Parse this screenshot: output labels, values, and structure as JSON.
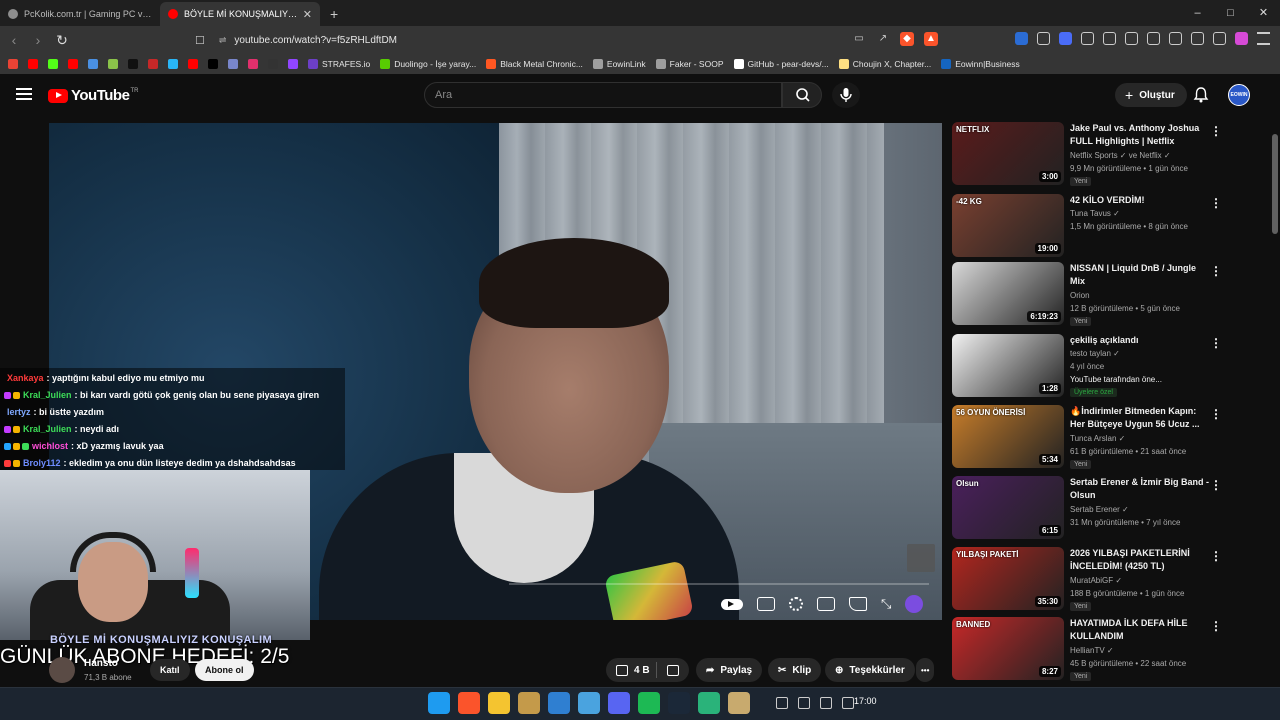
{
  "browser": {
    "tabs": [
      {
        "title": "PcKolik.com.tr | Gaming PC ve Bilgisayar",
        "active": false,
        "color": "#8e8e8e"
      },
      {
        "title": "BÖYLE Mİ KONUŞMALIYIZ KONUŞ",
        "active": true,
        "color": "#ff0000"
      }
    ],
    "new_tab": "+",
    "window_controls": [
      "–",
      "□",
      "✕"
    ],
    "url_site_label": "⇌",
    "url": "youtube.com/watch?v=f5zRHLdftDM",
    "bookmarks": [
      {
        "label": "",
        "color": "#ea4335"
      },
      {
        "label": "",
        "color": "#ff0000"
      },
      {
        "label": "",
        "color": "#53fc18"
      },
      {
        "label": "",
        "color": "#ff0000"
      },
      {
        "label": "",
        "color": "#4a90e2"
      },
      {
        "label": "",
        "color": "#8bc34a"
      },
      {
        "label": "",
        "color": "#111111"
      },
      {
        "label": "",
        "color": "#c62828"
      },
      {
        "label": "",
        "color": "#29b6f6"
      },
      {
        "label": "",
        "color": "#ff0000"
      },
      {
        "label": "",
        "color": "#000000"
      },
      {
        "label": "",
        "color": "#7986cb"
      },
      {
        "label": "",
        "color": "#e1306c"
      },
      {
        "label": "",
        "color": "#333333"
      },
      {
        "label": "",
        "color": "#9146ff"
      },
      {
        "label": "STRAFES.io",
        "color": "#6c3fc7"
      },
      {
        "label": "Duolingo - İşe yaray...",
        "color": "#58cc02"
      },
      {
        "label": "Black Metal Chronic...",
        "color": "#ff5722"
      },
      {
        "label": "EowinLink",
        "color": "#9e9e9e"
      },
      {
        "label": "Faker - SOOP",
        "color": "#9e9e9e"
      },
      {
        "label": "GitHub - pear-devs/...",
        "color": "#ffffff"
      },
      {
        "label": "Choujin X, Chapter...",
        "color": "#ffe082"
      },
      {
        "label": "Eowinn|Business",
        "color": "#1565c0"
      }
    ]
  },
  "youtube": {
    "logo_text": "YouTube",
    "country_code": "TR",
    "search_placeholder": "Ara",
    "create_label": "Oluştur",
    "avatar_label": "EOWIN"
  },
  "video": {
    "chat": [
      {
        "user": "Xankaya",
        "user_color": "#ff3b3b",
        "message": ": yaptığını kabul ediyo mu etmiyo mu",
        "badges": []
      },
      {
        "user": "Kral_Julien",
        "user_color": "#3ddc58",
        "message": ": bi karı vardı götü çok geniş olan bu sene piyasaya giren",
        "badges": [
          "#c43cff",
          "#f5b400"
        ]
      },
      {
        "user": "lertyz",
        "user_color": "#7fa8ff",
        "message": ": bi üstte yazdım",
        "badges": []
      },
      {
        "user": "Kral_Julien",
        "user_color": "#3ddc58",
        "message": ": neydi adı",
        "badges": [
          "#c43cff",
          "#f5b400"
        ]
      },
      {
        "user": "wichlost",
        "user_color": "#ff4fd8",
        "message": ": xD yazmış lavuk yaa",
        "badges": [
          "#23a6ff",
          "#f5b400",
          "#3ddc58"
        ]
      },
      {
        "user": "Broly112",
        "user_color": "#6f8dff",
        "message": ": ekledim ya onu dün listeye dedim ya dshahdsahdsas",
        "badges": [
          "#ff3b3b",
          "#f5b400"
        ]
      }
    ],
    "overlay_title": "BÖYLE Mİ KONUŞMALIYIZ KONUŞALIM",
    "overlay_goal": "GÜNLÜK ABONE HEDEFİ: 2/5"
  },
  "channel": {
    "name": "Hansto",
    "subscribers": "71,3 B abone",
    "join_label": "Katıl",
    "subscribe_label": "Abone ol"
  },
  "actions": {
    "likes": "4 B",
    "share": "Paylaş",
    "clip": "Klip",
    "thanks": "Teşekkürler",
    "more": "•••"
  },
  "recommendations": [
    {
      "title": "Jake Paul vs. Anthony Joshua FULL Highlights | Netflix",
      "channel": "Netflix Sports ✓ ve Netflix ✓",
      "meta": "9,9 Mn görüntüleme • 1 gün önce",
      "badge": "Yeni",
      "duration": "3:00",
      "thumb_label": "NETFLIX",
      "thumb_color": "#5a1b1b"
    },
    {
      "title": "42 KİLO VERDİM!",
      "channel": "Tuna Tavus ✓",
      "meta": "1,5 Mn görüntüleme • 8 gün önce",
      "badge": "",
      "duration": "19:00",
      "thumb_label": "-42 KG",
      "thumb_color": "#7a4030"
    },
    {
      "title": "NISSAN | Liquid DnB / Jungle Mix",
      "channel": "Orion",
      "meta": "12 B görüntüleme • 5 gün önce",
      "badge": "Yeni",
      "duration": "6:19:23",
      "thumb_label": "",
      "thumb_color": "#d9d9d9"
    },
    {
      "title": "çekiliş açıklandı",
      "channel": "testo taylan ✓",
      "meta": "4 yıl önce",
      "badge": "Üyelere özel",
      "extra": "YouTube tarafından öne...",
      "duration": "1:28",
      "thumb_label": "",
      "thumb_color": "#f2f2f2"
    },
    {
      "title": "🔥İndirimler Bitmeden Kapın: Her Bütçeye Uygun 56 Ucuz ...",
      "channel": "Tunca Arslan ✓",
      "meta": "61 B görüntüleme • 21 saat önce",
      "badge": "Yeni",
      "duration": "5:34",
      "thumb_label": "56 OYUN ÖNERİSİ",
      "thumb_color": "#c77d2a"
    },
    {
      "title": "Sertab Erener & İzmir Big Band - Olsun",
      "channel": "Sertab Erener ✓",
      "meta": "31 Mn görüntüleme • 7 yıl önce",
      "badge": "",
      "duration": "6:15",
      "thumb_label": "Olsun",
      "thumb_color": "#4a1f5c"
    },
    {
      "title": "2026 YILBAŞI PAKETLERİNİ İNCELEDİM! (4250 TL)",
      "channel": "MuratAbiGF ✓",
      "meta": "188 B görüntüleme • 1 gün önce",
      "badge": "Yeni",
      "duration": "35:30",
      "thumb_label": "YILBAŞI PAKETİ",
      "thumb_color": "#b3261e"
    },
    {
      "title": "HAYATIMDA İLK DEFA HİLE KULLANDIM",
      "channel": "HellianTV ✓",
      "meta": "45 B görüntüleme • 22 saat önce",
      "badge": "Yeni",
      "duration": "8:27",
      "thumb_label": "BANNED",
      "thumb_color": "#c62828"
    }
  ],
  "taskbar": {
    "apps": [
      {
        "name": "windows-start",
        "color": "#1e9bf0"
      },
      {
        "name": "brave",
        "color": "#fb542b"
      },
      {
        "name": "file-explorer",
        "color": "#f4c430"
      },
      {
        "name": "tools",
        "color": "#c49a4a"
      },
      {
        "name": "photos",
        "color": "#2f7fd1"
      },
      {
        "name": "app-shield",
        "color": "#4aa3df"
      },
      {
        "name": "discord",
        "color": "#5865f2"
      },
      {
        "name": "spotify",
        "color": "#1db954"
      },
      {
        "name": "steam",
        "color": "#1b2838"
      },
      {
        "name": "app-green",
        "color": "#2ab37a"
      },
      {
        "name": "league",
        "color": "#c8aa6e"
      }
    ],
    "time": "17:00"
  }
}
